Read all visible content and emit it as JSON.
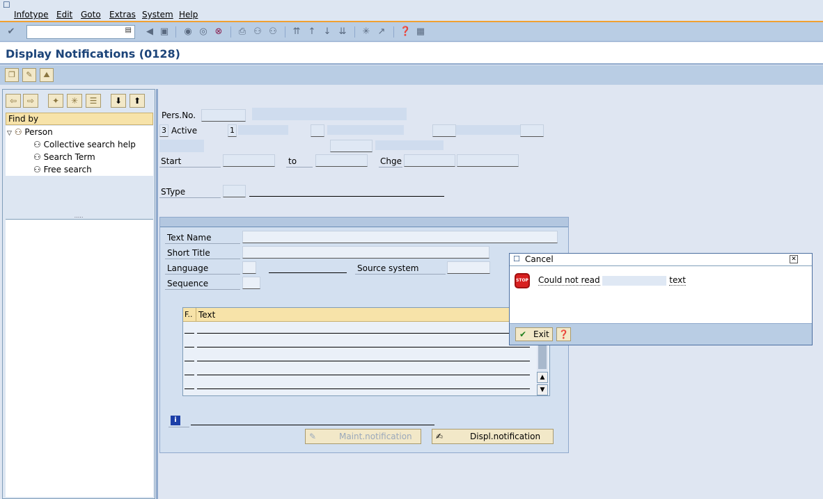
{
  "menu": [
    "Infotype",
    "Edit",
    "Goto",
    "Extras",
    "System",
    "Help"
  ],
  "menu_underline": [
    "I",
    "E",
    "G",
    "x",
    "S",
    "H"
  ],
  "title": "Display Notifications (0128)",
  "nav": {
    "find_by": "Find by",
    "person": "Person",
    "items": [
      "Collective search help",
      "Search Term",
      "Free search"
    ],
    "split_grip": "....."
  },
  "form": {
    "pers_no_label": "Pers.No.",
    "status_num": "3",
    "status_label": "Active",
    "field1_value": "1",
    "start_label": "Start",
    "to_label": "to",
    "chge_label": "Chge",
    "stype_label": "SType"
  },
  "group": {
    "text_name_label": "Text Name",
    "short_title_label": "Short Title",
    "language_label": "Language",
    "source_system_label": "Source system",
    "sequence_label": "Sequence",
    "table": {
      "col_f": "F..",
      "col_text": "Text",
      "rows": 5
    },
    "maint_button": "Maint.notification",
    "displ_button": "Displ.notification"
  },
  "dialog": {
    "title": "Cancel",
    "message_prefix": "Could not read",
    "message_suffix": "text",
    "exit_button": "Exit"
  },
  "colors": {
    "title": "#1c4479",
    "accent": "#f0a030",
    "toolbar": "#b9cde4"
  }
}
